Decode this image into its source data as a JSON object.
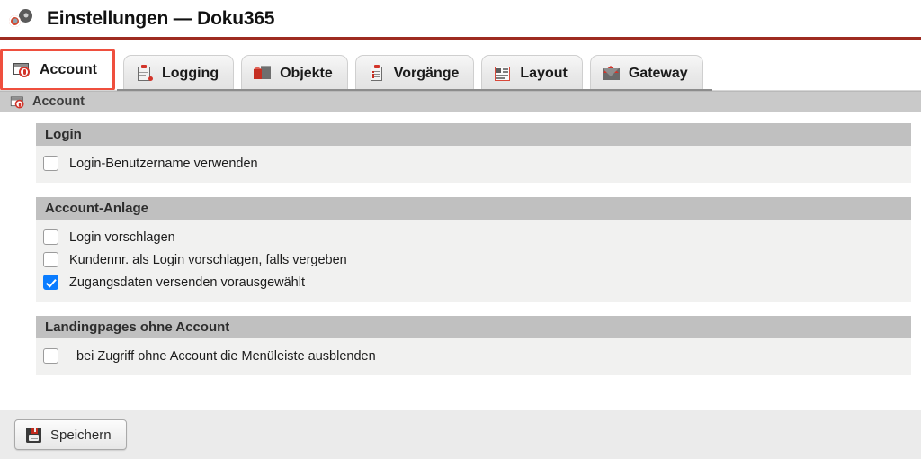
{
  "window": {
    "title": "Einstellungen — Doku365",
    "title_icon": "gears-icon"
  },
  "tabs": [
    {
      "label": "Account",
      "icon": "browser-account-icon",
      "active": true
    },
    {
      "label": "Logging",
      "icon": "clipboard-log-icon",
      "active": false
    },
    {
      "label": "Objekte",
      "icon": "boxes-icon",
      "active": false
    },
    {
      "label": "Vorgänge",
      "icon": "clipboard-list-icon",
      "active": false
    },
    {
      "label": "Layout",
      "icon": "page-layout-icon",
      "active": false
    },
    {
      "label": "Gateway",
      "icon": "envelope-icon",
      "active": false
    }
  ],
  "breadcrumb": {
    "label": "Account",
    "icon": "browser-account-icon"
  },
  "sections": [
    {
      "title": "Login",
      "rows": [
        {
          "label": "Login-Benutzername verwenden",
          "checked": false
        }
      ]
    },
    {
      "title": "Account-Anlage",
      "rows": [
        {
          "label": "Login vorschlagen",
          "checked": false
        },
        {
          "label": "Kundennr. als Login vorschlagen, falls vergeben",
          "checked": false
        },
        {
          "label": "Zugangsdaten versenden vorausgewählt",
          "checked": true
        }
      ]
    },
    {
      "title": "Landingpages ohne Account",
      "rows": [
        {
          "label": "bei Zugriff ohne Account die Menüleiste ausblenden",
          "checked": false,
          "extra_indent": true
        }
      ]
    }
  ],
  "footer": {
    "save_label": "Speichern",
    "save_icon": "floppy-disk-icon"
  },
  "colors": {
    "accent_red": "#d2342a",
    "active_tab_border": "#ef4f3e",
    "title_rule": "#9e2b20",
    "checkbox_checked": "#0a7cff",
    "section_header_bg": "#c0c0c0",
    "section_body_bg": "#f1f1f0"
  }
}
